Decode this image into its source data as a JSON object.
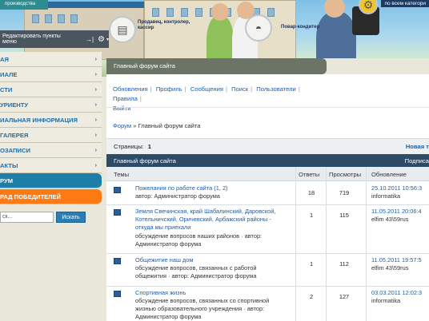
{
  "header": {
    "top_left_text": "производства",
    "top_right_text": "по всем категори",
    "caption_seller": "Продавец, контролер,\nкассир",
    "caption_cook": "Повар-кондитер",
    "brand_colors": {
      "teal": "#2e8b8f",
      "navy": "#1c3b63"
    }
  },
  "edit_strip": {
    "label": "Редактировать пункты меню",
    "arrow_icon": "→|",
    "gear_icon": "⚙",
    "caret_icon": "▾"
  },
  "sidebar": {
    "items": [
      {
        "label": "АЯ"
      },
      {
        "label": "ИАЛЕ"
      },
      {
        "label": "СТИ"
      },
      {
        "label": "УРИЕНТУ"
      },
      {
        "label": "ИАЛЬНАЯ ИНФОРМАЦИЯ"
      },
      {
        "label": "ГАЛЕРЕЯ"
      },
      {
        "label": "ОЗАПИСИ"
      },
      {
        "label": "АКТЫ"
      }
    ],
    "forum_label": "РУМ",
    "winners_label": "РАД ПОБЕДИТЕЛЕЙ",
    "search_value": "ск...",
    "search_button": "Искать"
  },
  "content": {
    "title": "Главный форум сайта",
    "nav_links": [
      "Обновления",
      "Профиль",
      "Сообщения",
      "Поиск",
      "Пользователи",
      "Правила",
      "Выйти"
    ],
    "breadcrumb": {
      "forum": "Форум",
      "sep": "»",
      "current": "Главный форум сайта"
    },
    "pages_label": "Страницы:",
    "pages_value": "1",
    "new_topic": "Новая т",
    "table_title": "Главный форум сайта",
    "subscribe": "Подписа",
    "columns": {
      "topics": "Темы",
      "replies": "Ответы",
      "views": "Просмотры",
      "updated": "Обновление"
    },
    "rows": [
      {
        "title": "Пожелания по работе сайта (1, 2)",
        "desc": "автор: Администратор форума",
        "replies": "18",
        "views": "719",
        "updated": "25.10.2011 10:56:3",
        "user": "informatika"
      },
      {
        "title": "Земля Свечинская, край Шабалинский, Даровской, Котельничский, Оричевский, Арбажский районы - откуда мы приехали",
        "desc": "обсуждение вопросов наших районов · автор: Администратор форума",
        "replies": "1",
        "views": "115",
        "updated": "11.05.2011 20:06:4",
        "user": "elfim 43\\59rus"
      },
      {
        "title": "Общежитие наш дом",
        "desc": "обсуждение вопросов, связанных с работой общежития · автор: Администратор форума",
        "replies": "1",
        "views": "112",
        "updated": "11.05.2011 19:57:5",
        "user": "elfim 43\\59rus"
      },
      {
        "title": "Спортивная жизнь",
        "desc": "обсуждение вопросов, связанных со спортивной жизнью образовательного учреждения · автор: Администратор форума",
        "replies": "2",
        "views": "127",
        "updated": "03.03.2011 12:02:3",
        "user": "informatika"
      }
    ]
  }
}
